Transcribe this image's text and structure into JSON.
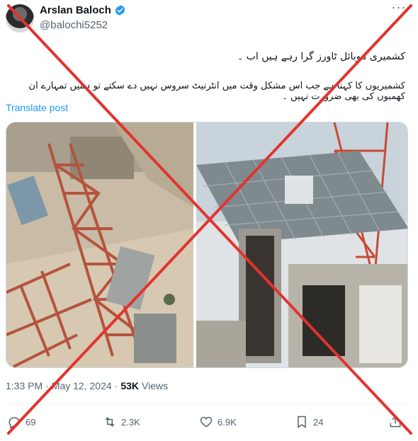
{
  "author": {
    "name": "Arslan Baloch",
    "handle": "@balochi5252",
    "verified_icon": "verified-badge-icon"
  },
  "post": {
    "text_line1": "کشمیری موبائل ٹاورز گرا رہے ہیں اب ۔",
    "text_line2": "کشمیریوں کا کہنا ہے جب اس مشکل وقت میں انٹرنیٹ سروس نہیں دے سکتے تو ہمیں تمہارے ان کھمبوں کی بھی ضرورت نہیں ۔",
    "translate_label": "Translate post"
  },
  "meta": {
    "time": "1:33 PM",
    "separator": "·",
    "date": "May 12, 2024",
    "views_count": "53K",
    "views_label": "Views"
  },
  "actions": {
    "replies": "69",
    "reposts": "2.3K",
    "likes": "6.9K",
    "bookmarks": "24"
  },
  "colors": {
    "accent": "#1d9bf0",
    "overlay_x": "#e3332f"
  }
}
